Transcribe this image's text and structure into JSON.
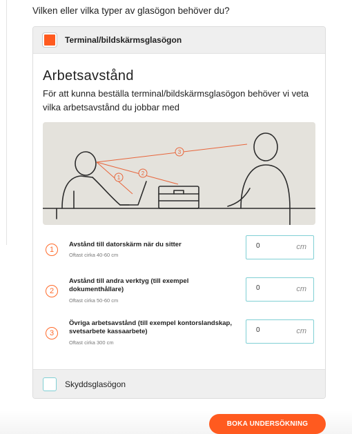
{
  "question": "Vilken eller vilka typer av glasögon behöver du?",
  "options": [
    {
      "label": "Terminal/bildskärmsglasögon",
      "checked": true
    },
    {
      "label": "Skyddsglasögon",
      "checked": false
    }
  ],
  "section": {
    "title": "Arbetsavstånd",
    "description": "För att kunna beställa terminal/bildskärmsglasögon behöver vi veta vilka arbetsavstånd du jobbar med"
  },
  "illustration": {
    "markers": [
      "1",
      "2",
      "3"
    ]
  },
  "distances": [
    {
      "num": "1",
      "label": "Avstånd till datorskärm när du sitter",
      "hint": "Oftast cirka 40-60 cm",
      "value": "0",
      "unit": "cm"
    },
    {
      "num": "2",
      "label": "Avstånd till andra verktyg (till exempel dokumenthållare)",
      "hint": "Oftast cirka 50-60 cm",
      "value": "0",
      "unit": "cm"
    },
    {
      "num": "3",
      "label": "Övriga arbetsavstånd (till exempel kontorslandskap, svetsarbete kassaarbete)",
      "hint": "Oftast cirka 300 cm",
      "value": "0",
      "unit": "cm"
    }
  ],
  "cta": "BOKA UNDERSÖKNING",
  "colors": {
    "accent": "#ff5a1f",
    "field_border": "#7fcfd4",
    "illustration_bg": "#e4e2dc"
  }
}
